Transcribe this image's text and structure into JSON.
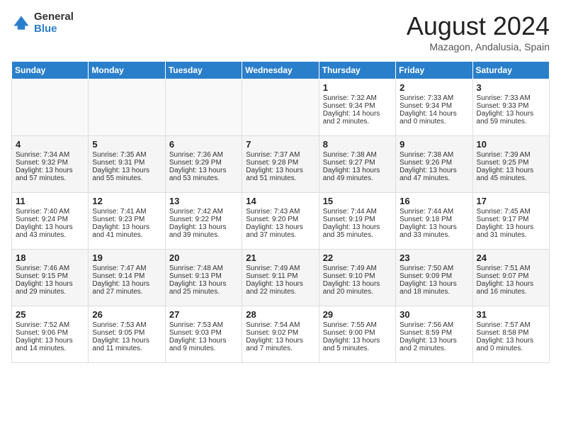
{
  "logo": {
    "general": "General",
    "blue": "Blue"
  },
  "title": "August 2024",
  "subtitle": "Mazagon, Andalusia, Spain",
  "days_of_week": [
    "Sunday",
    "Monday",
    "Tuesday",
    "Wednesday",
    "Thursday",
    "Friday",
    "Saturday"
  ],
  "weeks": [
    [
      {
        "day": "",
        "content": ""
      },
      {
        "day": "",
        "content": ""
      },
      {
        "day": "",
        "content": ""
      },
      {
        "day": "",
        "content": ""
      },
      {
        "day": "1",
        "content": "Sunrise: 7:32 AM\nSunset: 9:34 PM\nDaylight: 14 hours\nand 2 minutes."
      },
      {
        "day": "2",
        "content": "Sunrise: 7:33 AM\nSunset: 9:34 PM\nDaylight: 14 hours\nand 0 minutes."
      },
      {
        "day": "3",
        "content": "Sunrise: 7:33 AM\nSunset: 9:33 PM\nDaylight: 13 hours\nand 59 minutes."
      }
    ],
    [
      {
        "day": "4",
        "content": "Sunrise: 7:34 AM\nSunset: 9:32 PM\nDaylight: 13 hours\nand 57 minutes."
      },
      {
        "day": "5",
        "content": "Sunrise: 7:35 AM\nSunset: 9:31 PM\nDaylight: 13 hours\nand 55 minutes."
      },
      {
        "day": "6",
        "content": "Sunrise: 7:36 AM\nSunset: 9:29 PM\nDaylight: 13 hours\nand 53 minutes."
      },
      {
        "day": "7",
        "content": "Sunrise: 7:37 AM\nSunset: 9:28 PM\nDaylight: 13 hours\nand 51 minutes."
      },
      {
        "day": "8",
        "content": "Sunrise: 7:38 AM\nSunset: 9:27 PM\nDaylight: 13 hours\nand 49 minutes."
      },
      {
        "day": "9",
        "content": "Sunrise: 7:38 AM\nSunset: 9:26 PM\nDaylight: 13 hours\nand 47 minutes."
      },
      {
        "day": "10",
        "content": "Sunrise: 7:39 AM\nSunset: 9:25 PM\nDaylight: 13 hours\nand 45 minutes."
      }
    ],
    [
      {
        "day": "11",
        "content": "Sunrise: 7:40 AM\nSunset: 9:24 PM\nDaylight: 13 hours\nand 43 minutes."
      },
      {
        "day": "12",
        "content": "Sunrise: 7:41 AM\nSunset: 9:23 PM\nDaylight: 13 hours\nand 41 minutes."
      },
      {
        "day": "13",
        "content": "Sunrise: 7:42 AM\nSunset: 9:22 PM\nDaylight: 13 hours\nand 39 minutes."
      },
      {
        "day": "14",
        "content": "Sunrise: 7:43 AM\nSunset: 9:20 PM\nDaylight: 13 hours\nand 37 minutes."
      },
      {
        "day": "15",
        "content": "Sunrise: 7:44 AM\nSunset: 9:19 PM\nDaylight: 13 hours\nand 35 minutes."
      },
      {
        "day": "16",
        "content": "Sunrise: 7:44 AM\nSunset: 9:18 PM\nDaylight: 13 hours\nand 33 minutes."
      },
      {
        "day": "17",
        "content": "Sunrise: 7:45 AM\nSunset: 9:17 PM\nDaylight: 13 hours\nand 31 minutes."
      }
    ],
    [
      {
        "day": "18",
        "content": "Sunrise: 7:46 AM\nSunset: 9:15 PM\nDaylight: 13 hours\nand 29 minutes."
      },
      {
        "day": "19",
        "content": "Sunrise: 7:47 AM\nSunset: 9:14 PM\nDaylight: 13 hours\nand 27 minutes."
      },
      {
        "day": "20",
        "content": "Sunrise: 7:48 AM\nSunset: 9:13 PM\nDaylight: 13 hours\nand 25 minutes."
      },
      {
        "day": "21",
        "content": "Sunrise: 7:49 AM\nSunset: 9:11 PM\nDaylight: 13 hours\nand 22 minutes."
      },
      {
        "day": "22",
        "content": "Sunrise: 7:49 AM\nSunset: 9:10 PM\nDaylight: 13 hours\nand 20 minutes."
      },
      {
        "day": "23",
        "content": "Sunrise: 7:50 AM\nSunset: 9:09 PM\nDaylight: 13 hours\nand 18 minutes."
      },
      {
        "day": "24",
        "content": "Sunrise: 7:51 AM\nSunset: 9:07 PM\nDaylight: 13 hours\nand 16 minutes."
      }
    ],
    [
      {
        "day": "25",
        "content": "Sunrise: 7:52 AM\nSunset: 9:06 PM\nDaylight: 13 hours\nand 14 minutes."
      },
      {
        "day": "26",
        "content": "Sunrise: 7:53 AM\nSunset: 9:05 PM\nDaylight: 13 hours\nand 11 minutes."
      },
      {
        "day": "27",
        "content": "Sunrise: 7:53 AM\nSunset: 9:03 PM\nDaylight: 13 hours\nand 9 minutes."
      },
      {
        "day": "28",
        "content": "Sunrise: 7:54 AM\nSunset: 9:02 PM\nDaylight: 13 hours\nand 7 minutes."
      },
      {
        "day": "29",
        "content": "Sunrise: 7:55 AM\nSunset: 9:00 PM\nDaylight: 13 hours\nand 5 minutes."
      },
      {
        "day": "30",
        "content": "Sunrise: 7:56 AM\nSunset: 8:59 PM\nDaylight: 13 hours\nand 2 minutes."
      },
      {
        "day": "31",
        "content": "Sunrise: 7:57 AM\nSunset: 8:58 PM\nDaylight: 13 hours\nand 0 minutes."
      }
    ]
  ]
}
